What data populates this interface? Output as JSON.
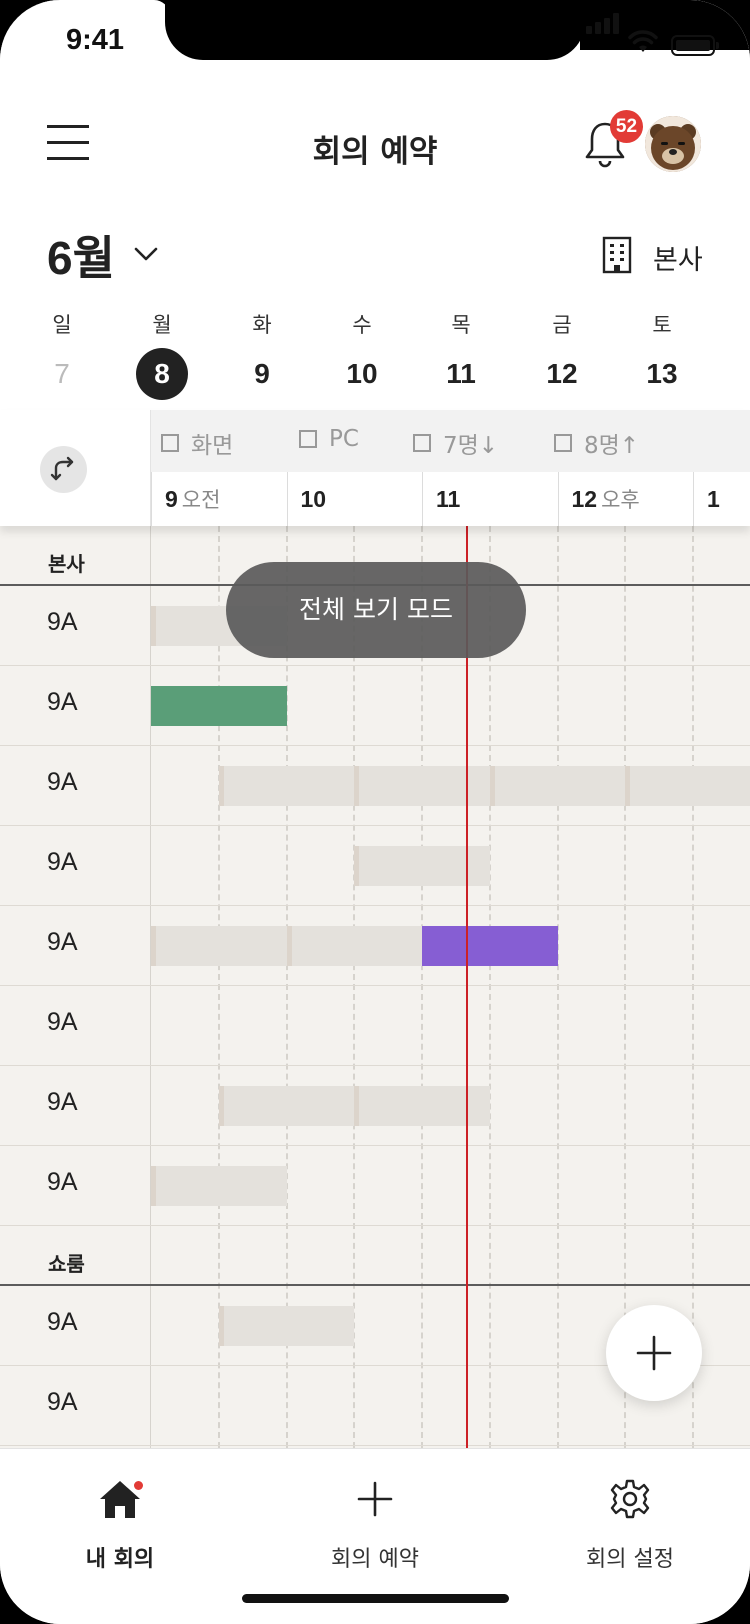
{
  "status": {
    "time": "9:41"
  },
  "header": {
    "title": "회의 예약",
    "notification_count": "52"
  },
  "calendar": {
    "month": "6월",
    "office": "본사",
    "days": [
      {
        "name": "일",
        "date": "7",
        "state": "muted"
      },
      {
        "name": "월",
        "date": "8",
        "state": "selected"
      },
      {
        "name": "화",
        "date": "9",
        "state": "normal"
      },
      {
        "name": "수",
        "date": "10",
        "state": "normal"
      },
      {
        "name": "목",
        "date": "11",
        "state": "normal"
      },
      {
        "name": "금",
        "date": "12",
        "state": "normal"
      },
      {
        "name": "토",
        "date": "13",
        "state": "normal"
      }
    ]
  },
  "filters": [
    {
      "label": "화면"
    },
    {
      "label": "PC"
    },
    {
      "label": "7명↓"
    },
    {
      "label": "8명↑"
    }
  ],
  "timeline": {
    "hours": [
      {
        "hour": "9",
        "ampm": "오전"
      },
      {
        "hour": "10",
        "ampm": ""
      },
      {
        "hour": "11",
        "ampm": ""
      },
      {
        "hour": "12",
        "ampm": "오후"
      },
      {
        "hour": "1",
        "ampm": ""
      }
    ],
    "now_time": "11:20"
  },
  "toast": "전체 보기 모드",
  "sections": [
    {
      "name": "본사",
      "rooms": [
        {
          "label": "9A",
          "bookings": [
            {
              "start": "9:00",
              "end": "10:00",
              "kind": "busy"
            }
          ]
        },
        {
          "label": "9A",
          "bookings": [
            {
              "start": "9:00",
              "end": "10:00",
              "kind": "mine"
            }
          ]
        },
        {
          "label": "9A",
          "bookings": [
            {
              "start": "9:30",
              "end": "10:30",
              "kind": "busy"
            },
            {
              "start": "10:30",
              "end": "11:30",
              "kind": "busy"
            },
            {
              "start": "11:30",
              "end": "12:30",
              "kind": "busy"
            },
            {
              "start": "12:30",
              "end": "1:30",
              "kind": "busy"
            }
          ]
        },
        {
          "label": "9A",
          "bookings": [
            {
              "start": "10:30",
              "end": "11:30",
              "kind": "busy"
            }
          ]
        },
        {
          "label": "9A",
          "bookings": [
            {
              "start": "9:00",
              "end": "10:00",
              "kind": "busy"
            },
            {
              "start": "10:00",
              "end": "11:00",
              "kind": "busy"
            },
            {
              "start": "11:00",
              "end": "12:00",
              "kind": "other"
            }
          ]
        },
        {
          "label": "9A",
          "bookings": []
        },
        {
          "label": "9A",
          "bookings": [
            {
              "start": "9:30",
              "end": "10:30",
              "kind": "busy"
            },
            {
              "start": "10:30",
              "end": "11:30",
              "kind": "busy"
            }
          ]
        },
        {
          "label": "9A",
          "bookings": [
            {
              "start": "9:00",
              "end": "10:00",
              "kind": "busy"
            }
          ]
        }
      ]
    },
    {
      "name": "쇼룸",
      "rooms": [
        {
          "label": "9A",
          "bookings": [
            {
              "start": "9:30",
              "end": "10:30",
              "kind": "busy"
            }
          ]
        },
        {
          "label": "9A",
          "bookings": []
        }
      ]
    }
  ],
  "tabs": [
    {
      "label": "내 회의",
      "icon": "home-icon",
      "active": true,
      "has_dot": true
    },
    {
      "label": "회의 예약",
      "icon": "plus-icon",
      "active": false,
      "has_dot": false
    },
    {
      "label": "회의 설정",
      "icon": "gear-icon",
      "active": false,
      "has_dot": false
    }
  ],
  "colors": {
    "mine": "#5a9e78",
    "other": "#865ed3",
    "busy": "#e4e1dc",
    "now_line": "#cc2026",
    "badge": "#e23b36"
  }
}
